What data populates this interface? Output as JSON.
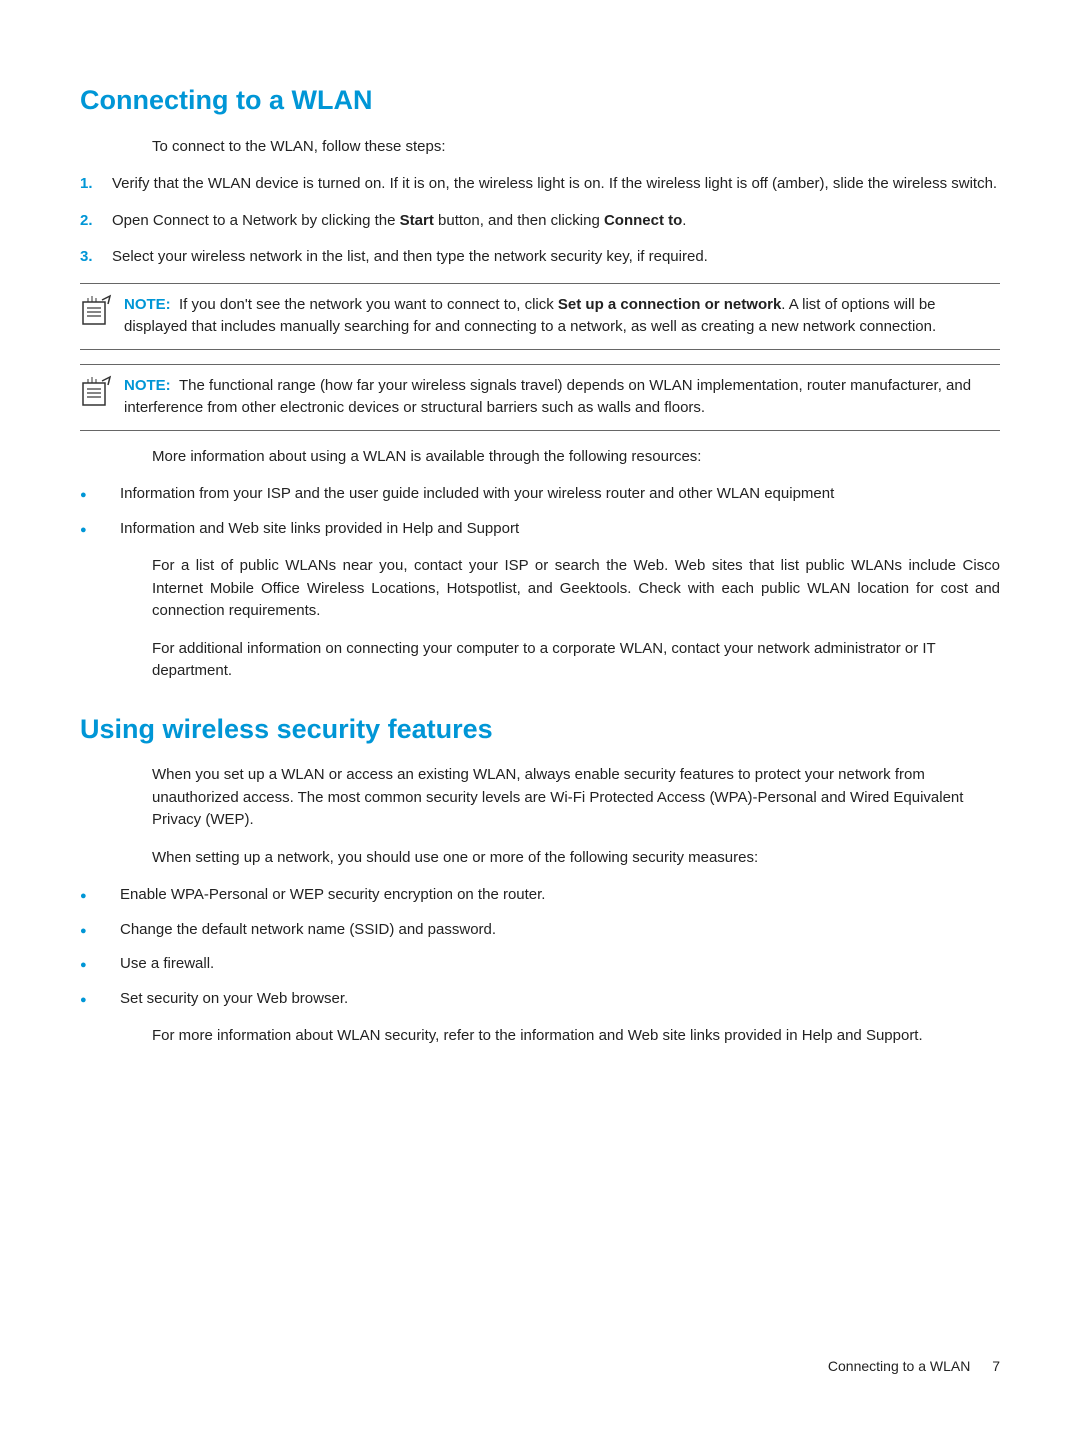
{
  "section1": {
    "heading": "Connecting to a WLAN",
    "intro": "To connect to the WLAN, follow these steps:",
    "steps": [
      "Verify that the WLAN device is turned on. If it is on, the wireless light is on. If the wireless light is off (amber), slide the wireless switch.",
      "Open Connect to a Network by clicking the __B__Start__/B__ button, and then clicking __B__Connect to__/B__.",
      "Select your wireless network in the list, and then type the network security key, if required."
    ],
    "note1_label": "NOTE:",
    "note1_body": "If you don't see the network you want to connect to, click __B__Set up a connection or network__/B__. A list of options will be displayed that includes manually searching for and connecting to a network, as well as creating a new network connection.",
    "note2_label": "NOTE:",
    "note2_body": "The functional range (how far your wireless signals travel) depends on WLAN implementation, router manufacturer, and interference from other electronic devices or structural barriers such as walls and floors.",
    "more": "More information about using a WLAN is available through the following resources:",
    "bullets": [
      "Information from your ISP and the user guide included with your wireless router and other WLAN equipment",
      "Information and Web site links provided in Help and Support"
    ],
    "para1": "For a list of public WLANs near you, contact your ISP or search the Web. Web sites that list public WLANs include Cisco Internet Mobile Office Wireless Locations, Hotspotlist, and Geektools. Check with each public WLAN location for cost and connection requirements.",
    "para2": "For additional information on connecting your computer to a corporate WLAN, contact your network administrator or IT department."
  },
  "section2": {
    "heading": "Using wireless security features",
    "para1": "When you set up a WLAN or access an existing WLAN, always enable security features to protect your network from unauthorized access. The most common security levels are Wi-Fi Protected Access (WPA)-Personal and Wired Equivalent Privacy (WEP).",
    "para2": "When setting up a network, you should use one or more of the following security measures:",
    "bullets": [
      "Enable WPA-Personal or WEP security encryption on the router.",
      "Change the default network name (SSID) and password.",
      "Use a firewall.",
      "Set security on your Web browser."
    ],
    "para3": "For more information about WLAN security, refer to the information and Web site links provided in Help and Support."
  },
  "footer": {
    "title": "Connecting to a WLAN",
    "page": "7"
  }
}
